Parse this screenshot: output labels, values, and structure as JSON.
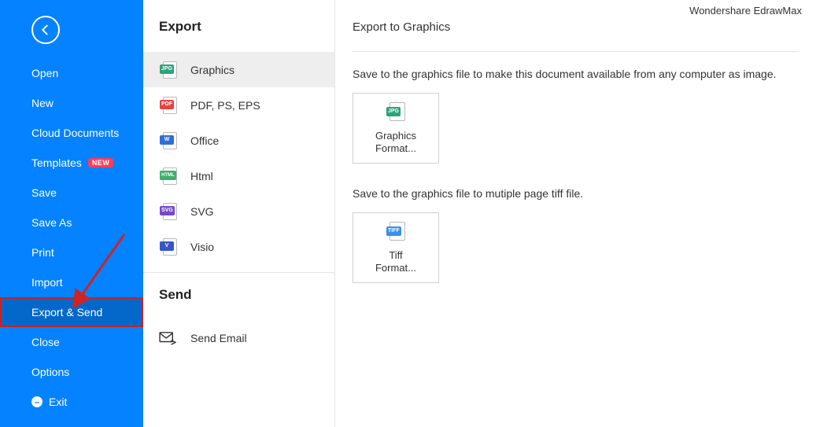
{
  "app_title": "Wondershare EdrawMax",
  "sidebar": {
    "items": [
      {
        "label": "Open"
      },
      {
        "label": "New"
      },
      {
        "label": "Cloud Documents"
      },
      {
        "label": "Templates",
        "badge": "NEW"
      },
      {
        "label": "Save"
      },
      {
        "label": "Save As"
      },
      {
        "label": "Print"
      },
      {
        "label": "Import"
      },
      {
        "label": "Export & Send",
        "selected": true
      },
      {
        "label": "Close"
      },
      {
        "label": "Options"
      },
      {
        "label": "Exit",
        "exit": true
      }
    ]
  },
  "midcol": {
    "export_header": "Export",
    "send_header": "Send",
    "export_items": [
      {
        "label": "Graphics",
        "badge_text": "JPG",
        "badge_color": "#2AA47A",
        "selected": true
      },
      {
        "label": "PDF, PS, EPS",
        "badge_text": "PDF",
        "badge_color": "#E34343"
      },
      {
        "label": "Office",
        "badge_text": "W",
        "badge_color": "#2F6FD6"
      },
      {
        "label": "Html",
        "badge_text": "HTML",
        "badge_color": "#3FAE6B",
        "small": true
      },
      {
        "label": "SVG",
        "badge_text": "SVG",
        "badge_color": "#7748C8"
      },
      {
        "label": "Visio",
        "badge_text": "V",
        "badge_color": "#3456C9"
      }
    ],
    "send_items": [
      {
        "label": "Send Email"
      }
    ]
  },
  "main": {
    "header": "Export to Graphics",
    "desc1": "Save to the graphics file to make this document available from any computer as image.",
    "tile1": {
      "badge_text": "JPG",
      "badge_color": "#2AA47A",
      "label_line1": "Graphics",
      "label_line2": "Format..."
    },
    "desc2": "Save to the graphics file to mutiple page tiff file.",
    "tile2": {
      "badge_text": "TIFF",
      "badge_color": "#3890F0",
      "label_line1": "Tiff",
      "label_line2": "Format..."
    }
  }
}
